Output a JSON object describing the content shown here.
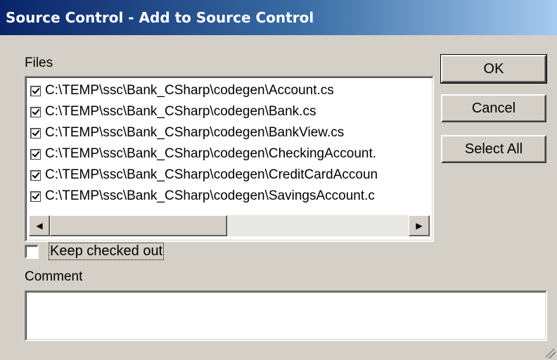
{
  "window": {
    "title": "Source Control - Add to Source Control"
  },
  "files_section": {
    "label": "Files",
    "items": [
      {
        "path": "C:\\TEMP\\ssc\\Bank_CSharp\\codegen\\Account.cs",
        "checked": true
      },
      {
        "path": "C:\\TEMP\\ssc\\Bank_CSharp\\codegen\\Bank.cs",
        "checked": true
      },
      {
        "path": "C:\\TEMP\\ssc\\Bank_CSharp\\codegen\\BankView.cs",
        "checked": true
      },
      {
        "path": "C:\\TEMP\\ssc\\Bank_CSharp\\codegen\\CheckingAccount.",
        "checked": true
      },
      {
        "path": "C:\\TEMP\\ssc\\Bank_CSharp\\codegen\\CreditCardAccoun",
        "checked": true
      },
      {
        "path": "C:\\TEMP\\ssc\\Bank_CSharp\\codegen\\SavingsAccount.c",
        "checked": true
      }
    ]
  },
  "buttons": {
    "ok": "OK",
    "cancel": "Cancel",
    "select_all": "Select All"
  },
  "keep_checked_out": {
    "label": "Keep checked out",
    "checked": false
  },
  "comment": {
    "label": "Comment",
    "value": ""
  },
  "icons": {
    "scroll_left": "left-arrow-icon",
    "scroll_right": "right-arrow-icon",
    "resize_grip": "resize-grip-icon"
  },
  "colors": {
    "titlebar_start": "#0a246a",
    "titlebar_end": "#a6caf0",
    "dialog_bg": "#d4d0c8"
  }
}
